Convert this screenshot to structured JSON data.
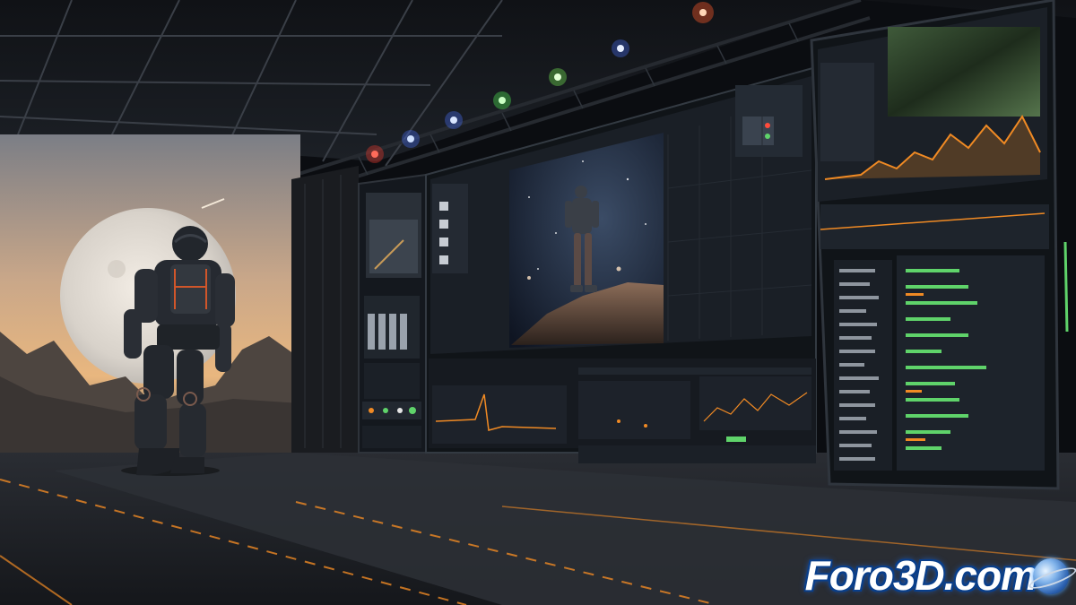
{
  "watermark": {
    "text": "Foro3D.com"
  },
  "scene": {
    "description_icons": [
      "moon",
      "astronaut",
      "mountain",
      "stage-light",
      "monitor-wall"
    ],
    "colors": {
      "sky_warm": "#e7b98a",
      "sky_cool": "#6f7a8a",
      "floor": "#23262b",
      "screen_bg": "#15191f",
      "accent_orange": "#f08a24",
      "accent_green": "#5fd36a",
      "brand_blue": "#1e6ff0"
    }
  }
}
